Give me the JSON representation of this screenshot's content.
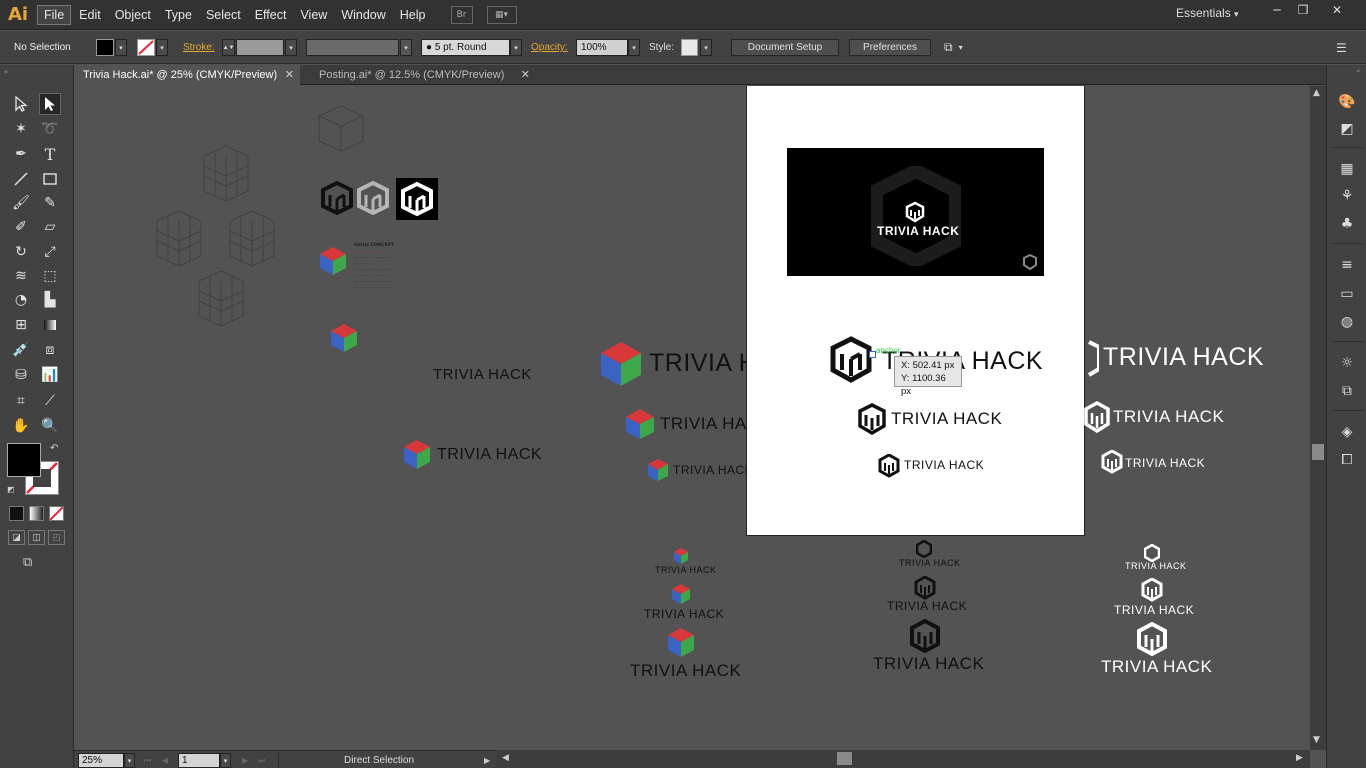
{
  "app": {
    "logo": "Ai",
    "workspace": "Essentials",
    "workspace_caret": "▾"
  },
  "menu": [
    "File",
    "Edit",
    "Object",
    "Type",
    "Select",
    "Effect",
    "View",
    "Window",
    "Help"
  ],
  "menu_extras": {
    "bridge": "Br",
    "arrange": "▦▾"
  },
  "window_controls": {
    "minimize": "─",
    "restore": "❐",
    "close": "✕"
  },
  "control": {
    "selection": "No Selection",
    "stroke_label": "Stroke:",
    "brush": "● 5 pt. Round",
    "opacity_label": "Opacity:",
    "opacity": "100%",
    "style_label": "Style:",
    "document_setup": "Document Setup",
    "preferences": "Preferences"
  },
  "tabs": [
    {
      "label": "Trivia Hack.ai* @ 25% (CMYK/Preview)",
      "close": "✕"
    },
    {
      "label": "Posting.ai* @ 12.5% (CMYK/Preview)",
      "close": "✕"
    }
  ],
  "tools": {
    "selection": "selection-tool",
    "direct": "direct-selection-tool",
    "magic": "magic-wand-tool",
    "lasso": "lasso-tool",
    "pen": "pen-tool",
    "type": "T",
    "line": "line-tool",
    "rect": "rectangle-tool",
    "brush": "paintbrush-tool",
    "pencil": "pencil-tool",
    "blob": "blob-brush-tool",
    "eraser": "eraser-tool",
    "rotate": "rotate-tool",
    "scale": "scale-tool",
    "warp": "warp-tool",
    "free": "free-transform-tool",
    "shape": "shape-builder-tool",
    "graph": "graph-tool",
    "mesh": "mesh-tool",
    "gradient": "gradient-tool",
    "eyedrop": "eyedropper-tool",
    "blend": "blend-tool",
    "symbol": "symbol-sprayer-tool",
    "column": "column-graph-tool",
    "artboard": "artboard-tool",
    "slice": "slice-tool",
    "hand": "hand-tool",
    "zoom": "zoom-tool"
  },
  "canvas": {
    "brand": "TRIVIA HACK",
    "notes_title": "Initial CONCEPT",
    "notes_lines": [
      "..........................",
      "..........................",
      "............",
      "..........................",
      "..........................",
      "..........................",
      "..........................",
      "..........................",
      ".........................."
    ]
  },
  "tooltip": {
    "anchor": "anchor",
    "x": "X: 502.41 px",
    "y": "Y: 1100.36 px"
  },
  "status": {
    "zoom": "25%",
    "page": "1",
    "tool": "Direct Selection"
  },
  "colors": {
    "orange": "#e8a634",
    "red": "#d9383a",
    "green": "#3ca84a",
    "blue": "#3b63c4"
  }
}
